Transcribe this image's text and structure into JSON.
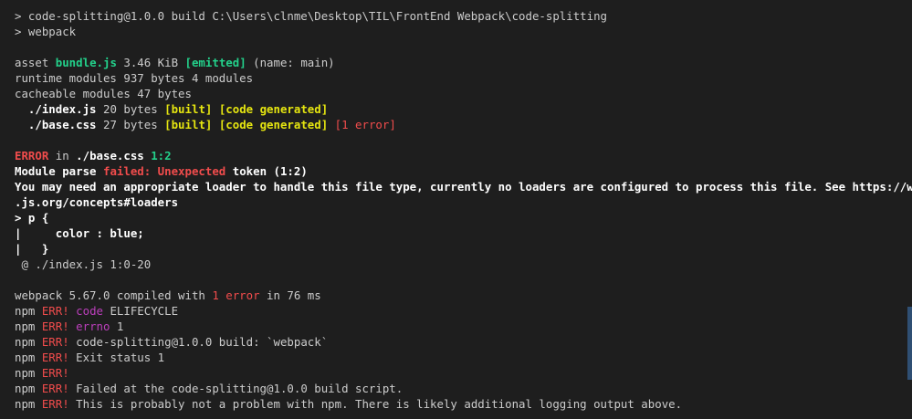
{
  "cmd": {
    "line1": "> code-splitting@1.0.0 build C:\\Users\\clnme\\Desktop\\TIL\\FrontEnd Webpack\\code-splitting",
    "line2": "> webpack"
  },
  "asset": {
    "prefix": "asset ",
    "name": "bundle.js",
    "size": " 3.46 KiB ",
    "emitted": "[emitted]",
    "suffix": " (name: main)"
  },
  "runtime": "runtime modules 937 bytes 4 modules",
  "cacheable": "cacheable modules 47 bytes",
  "module_index": {
    "path": "./index.js",
    "size": " 20 bytes ",
    "built": "[built]",
    "generated": "[code generated]"
  },
  "module_base": {
    "path": "./base.css",
    "size": " 27 bytes ",
    "built": "[built]",
    "generated": "[code generated]",
    "error": "[1 error]"
  },
  "error": {
    "label": "ERROR",
    "in": " in ",
    "file": "./base.css",
    "pos": " 1:2",
    "parse_prefix": "Module parse ",
    "failed": "failed:",
    "unexpected": "Unexpected",
    "token": " token (1:2)",
    "msg1": "You may need an appropriate loader to handle this file type, currently no loaders are configured to process this file. See https://webpack",
    "msg2": ".js.org/concepts#loaders",
    "code1": "> p {",
    "code2": "|     color : blue;",
    "code3": "|   }",
    "at": " @ ./index.js 1:0-20"
  },
  "compiled": {
    "prefix": "webpack 5.67.0 compiled with ",
    "errors": "1 error",
    "suffix": " in 76 ms"
  },
  "npm": {
    "prefix": "npm ",
    "err": "ERR!",
    "lines": [
      {
        "key": "code",
        "text": " ELIFECYCLE"
      },
      {
        "key": "errno",
        "text": " 1"
      },
      {
        "key": "",
        "text": " code-splitting@1.0.0 build: `webpack`"
      },
      {
        "key": "",
        "text": " Exit status 1"
      },
      {
        "key": "",
        "text": ""
      },
      {
        "key": "",
        "text": " Failed at the code-splitting@1.0.0 build script."
      },
      {
        "key": "",
        "text": " This is probably not a problem with npm. There is likely additional logging output above."
      }
    ]
  }
}
